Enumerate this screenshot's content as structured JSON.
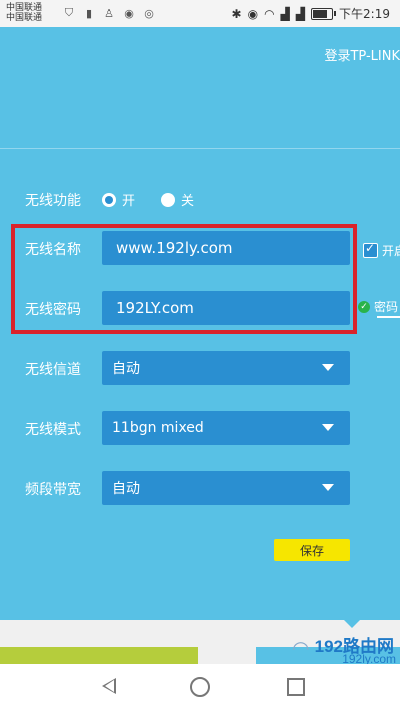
{
  "status_bar": {
    "carrier1": "中国联通",
    "carrier2": "中国联通",
    "time": "下午2:19",
    "left_icons": [
      "shield-icon",
      "sim-icon",
      "qq-icon",
      "weibo-eye-icon",
      "weibo-icon"
    ],
    "right_icons": [
      "bluetooth-icon",
      "eye-icon",
      "wifi-icon",
      "signal-4g-icon",
      "signal-2g-icon",
      "battery-icon"
    ]
  },
  "header": {
    "login_link": "登录TP-LINK"
  },
  "wireless": {
    "function_label": "无线功能",
    "radio_on_label": "开",
    "radio_off_label": "关",
    "name_label": "无线名称",
    "name_value": "www.192ly.com",
    "password_label": "无线密码",
    "password_value": "192LY.com",
    "channel_label": "无线信道",
    "channel_value": "自动",
    "mode_label": "无线模式",
    "mode_value": "11bgn mixed",
    "bandwidth_label": "频段带宽",
    "bandwidth_value": "自动",
    "side_broadcast_label": "开启",
    "side_password_label": "密码",
    "save_label": "保存"
  },
  "watermark": {
    "title": "192路由网",
    "url": "192ly.com"
  },
  "colors": {
    "background": "#58c1e5",
    "field": "#2a8fd1",
    "highlight_border": "#d9232b",
    "save_button": "#f6e600"
  }
}
